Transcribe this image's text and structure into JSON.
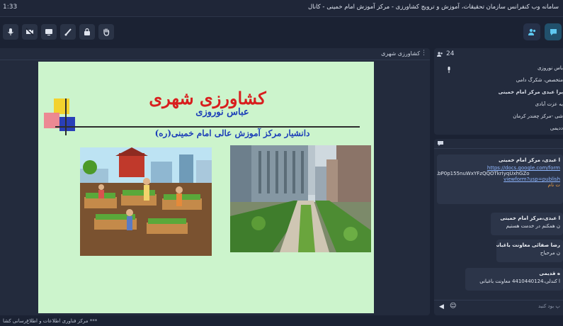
{
  "window": {
    "time": "1:33",
    "title": "سامانه وب کنفرانس سازمان تحقیقات، آموزش و ترویج کشاورزی - مرکز آموزش امام خمینی - کانال"
  },
  "toolbar": {
    "left_icons": [
      "mic-off-icon",
      "camera-off-icon",
      "screen-share-icon",
      "brush-icon",
      "lock-icon",
      "raise-hand-icon"
    ],
    "right_icons": [
      "participants-icon",
      "chat-icon"
    ]
  },
  "content": {
    "title": "کشاورزی شهری",
    "slide": {
      "title": "کشاورزی شهری",
      "author": "عباس نوروزی",
      "affiliation": "دانشیار مرکز آموزش عالی امام خمینی(ره)"
    }
  },
  "participants": {
    "count": "24",
    "items": [
      "باس نوروزی",
      "متخصص، شکرگ دامی",
      "یرا عبدی مرکز امام خمینی",
      "یه عزت آبادی",
      "شی -مرکز چغندر کرمان",
      "ددیمی"
    ]
  },
  "chat": {
    "messages": [
      {
        "name": "ا عبدی، مرکز امام خمینی",
        "link_lines": [
          "https://docs.google.com/form",
          "TXyLbP0p155nuWxYFzQQOTkrIyqUxhGZo",
          "viewform?usp=publish"
        ],
        "note": "ت نام"
      },
      {
        "name": "ا عبدی،مرکز امام خمینی",
        "line": "ن همکنم در خدمت هستیم"
      },
      {
        "name": "رضا صفائی معاونت باغبانی",
        "line": "ن مرحباح"
      },
      {
        "name": "ه قدیمی",
        "line": "ا کندلی،4410440124 معاونت باغبانی"
      }
    ],
    "input_placeholder": "پ بود کنید"
  },
  "status": {
    "text": "*** مرکز فناوری اطلاعات و اطلاع‌رسانی کشا"
  }
}
